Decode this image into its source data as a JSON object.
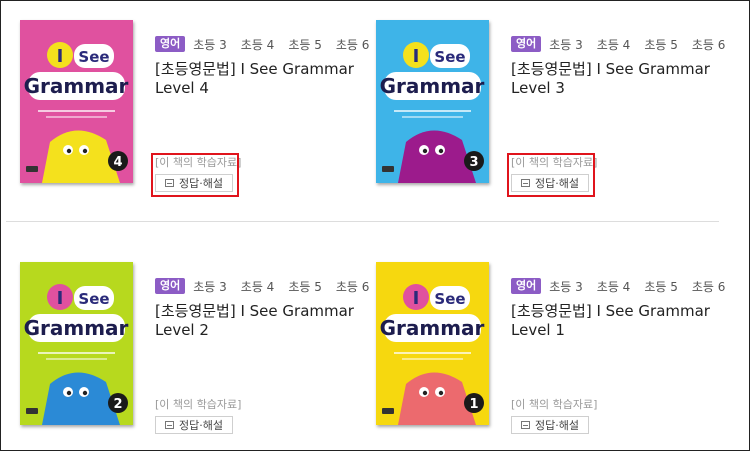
{
  "books": [
    {
      "subject": "영어",
      "grades": [
        "초등 3",
        "초등 4",
        "초등 5",
        "초등 6"
      ],
      "title": "[초등영문법] I See Grammar Level 4",
      "materials_label": "[이 책의 학습자료]",
      "answer_button": "정답·해설",
      "cover": {
        "bg": "#e0519f",
        "accent": "#f4e11d",
        "body_color": "#f4e11d",
        "level": "4",
        "word1": "I",
        "word2": "See",
        "word3": "Grammar"
      },
      "highlighted": true
    },
    {
      "subject": "영어",
      "grades": [
        "초등 3",
        "초등 4",
        "초등 5",
        "초등 6"
      ],
      "title": "[초등영문법] I See Grammar Level 3",
      "materials_label": "[이 책의 학습자료]",
      "answer_button": "정답·해설",
      "cover": {
        "bg": "#3eb4e8",
        "accent": "#f4e11d",
        "body_color": "#9c1b8c",
        "level": "3",
        "word1": "I",
        "word2": "See",
        "word3": "Grammar"
      },
      "highlighted": true
    },
    {
      "subject": "영어",
      "grades": [
        "초등 3",
        "초등 4",
        "초등 5",
        "초등 6"
      ],
      "title": "[초등영문법] I See Grammar Level 2",
      "materials_label": "[이 책의 학습자료]",
      "answer_button": "정답·해설",
      "cover": {
        "bg": "#b7d91e",
        "accent": "#e0519f",
        "body_color": "#2b8ad6",
        "level": "2",
        "word1": "I",
        "word2": "See",
        "word3": "Grammar"
      },
      "highlighted": false
    },
    {
      "subject": "영어",
      "grades": [
        "초등 3",
        "초등 4",
        "초등 5",
        "초등 6"
      ],
      "title": "[초등영문법] I See Grammar Level 1",
      "materials_label": "[이 책의 학습자료]",
      "answer_button": "정답·해설",
      "cover": {
        "bg": "#f6d80f",
        "accent": "#e0519f",
        "body_color": "#ec6a6e",
        "level": "1",
        "word1": "I",
        "word2": "See",
        "word3": "Grammar"
      },
      "highlighted": false
    }
  ]
}
